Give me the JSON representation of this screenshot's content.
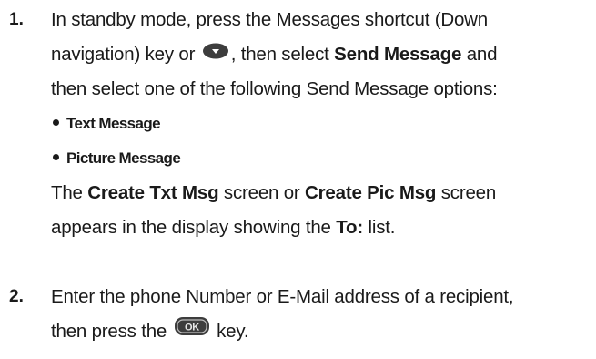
{
  "steps": [
    {
      "number": "1.",
      "intro": {
        "part1": "In standby mode, press the Messages shortcut (Down",
        "part2a": "navigation) key or",
        "down_key_icon": "down-navigation-key-icon",
        "part2b": ", then select",
        "send_message_bold": "Send Message",
        "part2c": "and",
        "part3": "then select one of the following Send Message options:"
      },
      "bullets": [
        "Text Message",
        "Picture Message"
      ],
      "result": {
        "the": "The",
        "create_txt_bold": "Create Txt Msg",
        "screen_or": "screen or",
        "create_pic_bold": "Create Pic Msg",
        "screen": "screen",
        "line2a": "appears in the display showing the",
        "to_bold": "To:",
        "line2b": "list."
      }
    },
    {
      "number": "2.",
      "line1": "Enter the phone Number or E-Mail address of a recipient,",
      "line2a": "then press the",
      "ok_key_icon": "ok-key-icon",
      "ok_key_label": "OK",
      "line2b": "key."
    }
  ]
}
